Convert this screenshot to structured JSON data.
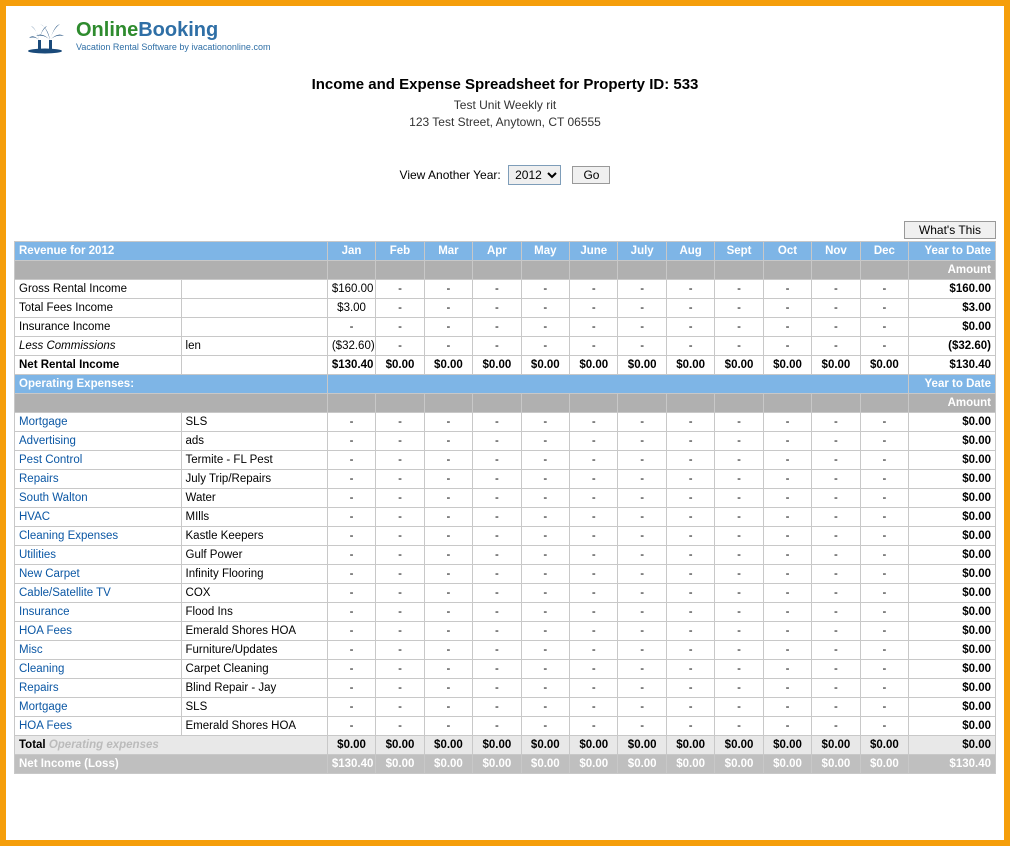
{
  "logo": {
    "green": "Online",
    "blue": "Booking",
    "sub": "Vacation Rental Software by ivacationonline.com"
  },
  "heading": {
    "title": "Income and Expense Spreadsheet for Property ID: 533",
    "unit": "Test Unit Weekly rit",
    "addr": "123 Test Street, Anytown, CT 06555"
  },
  "yearRow": {
    "label": "View Another Year:",
    "value": "2012",
    "go": "Go"
  },
  "whatsThis": "What's This",
  "months": [
    "Jan",
    "Feb",
    "Mar",
    "Apr",
    "May",
    "June",
    "July",
    "Aug",
    "Sept",
    "Oct",
    "Nov",
    "Dec"
  ],
  "revenueHeader": "Revenue for 2012",
  "ytdHeader": "Year to Date",
  "amountHeader": "Amount",
  "revenueRows": [
    {
      "label": "Gross Rental Income",
      "note": "",
      "vals": [
        "$160.00",
        "-",
        "-",
        "-",
        "-",
        "-",
        "-",
        "-",
        "-",
        "-",
        "-",
        "-"
      ],
      "ytd": "$160.00"
    },
    {
      "label": "Total Fees Income",
      "note": "",
      "vals": [
        "$3.00",
        "-",
        "-",
        "-",
        "-",
        "-",
        "-",
        "-",
        "-",
        "-",
        "-",
        "-"
      ],
      "ytd": "$3.00"
    },
    {
      "label": "Insurance Income",
      "note": "",
      "vals": [
        "-",
        "-",
        "-",
        "-",
        "-",
        "-",
        "-",
        "-",
        "-",
        "-",
        "-",
        "-"
      ],
      "ytd": "$0.00"
    },
    {
      "label": "Less Commissions",
      "note": "len",
      "vals": [
        "($32.60)",
        "-",
        "-",
        "-",
        "-",
        "-",
        "-",
        "-",
        "-",
        "-",
        "-",
        "-"
      ],
      "ytd": "($32.60)",
      "ital": true
    }
  ],
  "netRental": {
    "label": "Net Rental Income",
    "vals": [
      "$130.40",
      "$0.00",
      "$0.00",
      "$0.00",
      "$0.00",
      "$0.00",
      "$0.00",
      "$0.00",
      "$0.00",
      "$0.00",
      "$0.00",
      "$0.00"
    ],
    "ytd": "$130.40"
  },
  "opHeader": "Operating Expenses:",
  "opRows": [
    {
      "label": "Mortgage",
      "note": "SLS"
    },
    {
      "label": "Advertising",
      "note": "ads"
    },
    {
      "label": "Pest Control",
      "note": "Termite - FL Pest"
    },
    {
      "label": "Repairs",
      "note": "July Trip/Repairs"
    },
    {
      "label": "South Walton",
      "note": "Water"
    },
    {
      "label": "HVAC",
      "note": "MIlls"
    },
    {
      "label": "Cleaning Expenses",
      "note": "Kastle Keepers"
    },
    {
      "label": "Utilities",
      "note": "Gulf Power"
    },
    {
      "label": "New Carpet",
      "note": "Infinity Flooring"
    },
    {
      "label": "Cable/Satellite TV",
      "note": "COX"
    },
    {
      "label": "Insurance",
      "note": "Flood Ins"
    },
    {
      "label": "HOA Fees",
      "note": "Emerald Shores HOA"
    },
    {
      "label": "Misc",
      "note": "Furniture/Updates"
    },
    {
      "label": "Cleaning",
      "note": "Carpet Cleaning"
    },
    {
      "label": "Repairs",
      "note": "Blind Repair - Jay"
    },
    {
      "label": "Mortgage",
      "note": "SLS"
    },
    {
      "label": "HOA Fees",
      "note": "Emerald Shores HOA"
    }
  ],
  "opDash": "-",
  "opYtd": "$0.00",
  "totalOp": {
    "label": "Total",
    "faded": "Operating expenses",
    "vals": [
      "$0.00",
      "$0.00",
      "$0.00",
      "$0.00",
      "$0.00",
      "$0.00",
      "$0.00",
      "$0.00",
      "$0.00",
      "$0.00",
      "$0.00",
      "$0.00"
    ],
    "ytd": "$0.00"
  },
  "netLoss": {
    "label": "Net Income (Loss)",
    "vals": [
      "$130.40",
      "$0.00",
      "$0.00",
      "$0.00",
      "$0.00",
      "$0.00",
      "$0.00",
      "$0.00",
      "$0.00",
      "$0.00",
      "$0.00",
      "$0.00"
    ],
    "ytd": "$130.40"
  }
}
